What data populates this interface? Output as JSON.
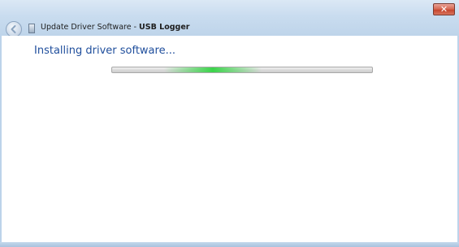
{
  "window": {
    "title_prefix": "Update Driver Software - ",
    "title_device": "USB Logger",
    "close_symbol": "✕"
  },
  "icons": {
    "back": "back-arrow-icon",
    "app": "device-icon",
    "close": "close-icon"
  },
  "main": {
    "heading": "Installing driver software..."
  },
  "progress": {
    "style": "indeterminate marquee",
    "glow_position": 0.2
  },
  "colors": {
    "heading": "#1f4e9c",
    "progress_glow": "#3bd44a",
    "close_button": "#d5664f"
  }
}
